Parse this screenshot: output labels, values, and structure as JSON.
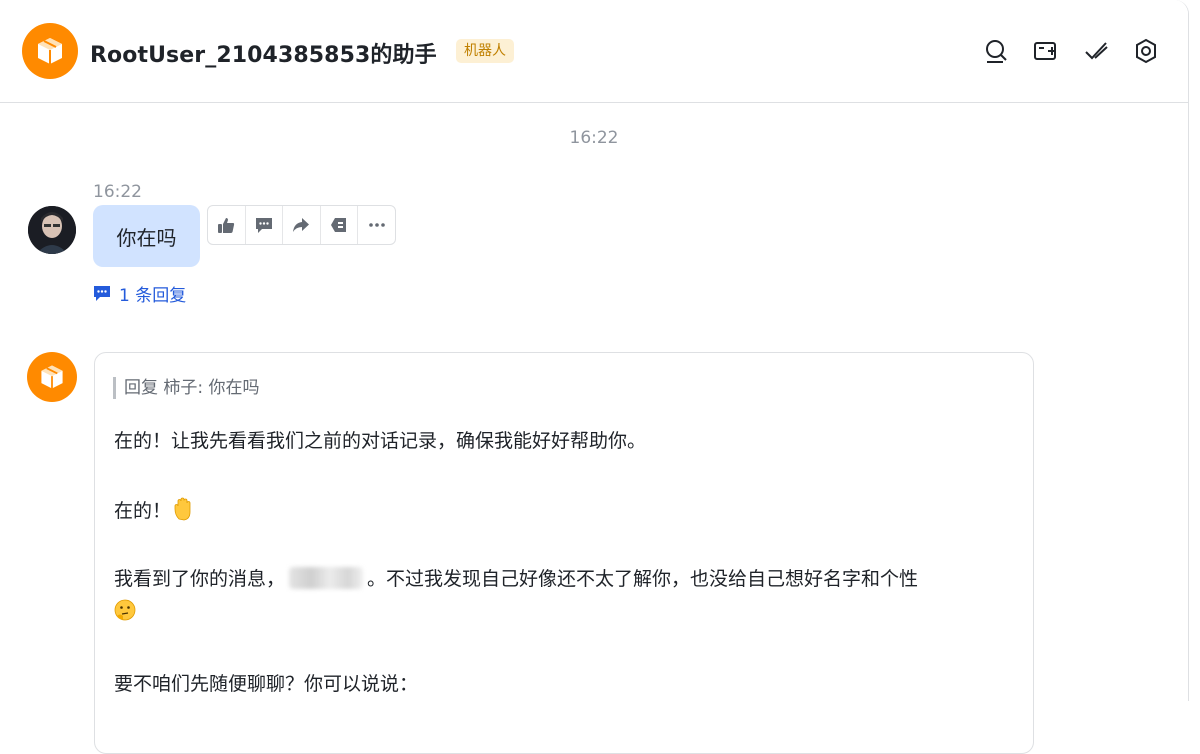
{
  "header": {
    "title": "RootUser_2104385853的助手",
    "badge": "机器人",
    "icons": [
      "search-icon",
      "add-chat-icon",
      "mark-done-icon",
      "settings-icon"
    ]
  },
  "chat": {
    "center_time": "16:22",
    "user_message": {
      "time": "16:22",
      "text": "你在吗",
      "reply_link": "1 条回复",
      "actions": [
        "thumbs-up-icon",
        "comment-icon",
        "forward-icon",
        "pin-icon",
        "more-icon"
      ]
    },
    "bot_message": {
      "quote": "回复 柿子: 你在吗",
      "line1": "在的！让我先看看我们之前的对话记录，确保我能好好帮助你。",
      "line2": "在的！",
      "line3_before": "我看到了你的消息，",
      "line3_after": "。不过我发现自己好像还不太了解你，也没给自己想好名字和个性",
      "line4": "要不咱们先随便聊聊？你可以说说："
    }
  },
  "colors": {
    "accent": "#245bdb",
    "bot_avatar": "#ff8a00",
    "user_bubble": "#d1e3ff",
    "badge_bg": "#fdf0d4",
    "badge_text": "#c08000"
  }
}
